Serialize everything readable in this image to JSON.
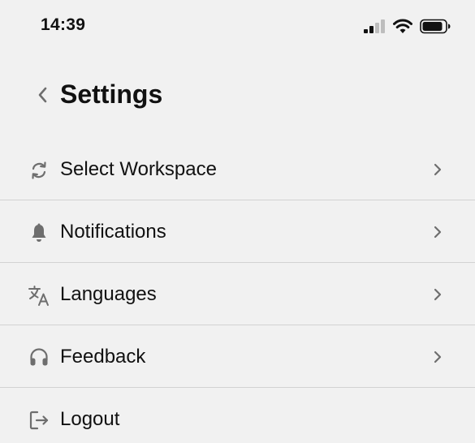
{
  "status_bar": {
    "time": "14:39",
    "icons": [
      "cellular-signal-icon",
      "wifi-icon",
      "battery-icon"
    ]
  },
  "header": {
    "back_icon": "chevron-left-icon",
    "title": "Settings"
  },
  "menu": {
    "items": [
      {
        "label": "Select Workspace",
        "icon": "sync-icon",
        "has_chevron": true
      },
      {
        "label": "Notifications",
        "icon": "bell-icon",
        "has_chevron": true
      },
      {
        "label": "Languages",
        "icon": "translate-icon",
        "has_chevron": true
      },
      {
        "label": "Feedback",
        "icon": "headset-icon",
        "has_chevron": true
      },
      {
        "label": "Logout",
        "icon": "logout-icon",
        "has_chevron": false
      }
    ]
  },
  "colors": {
    "background": "#f1f1f1",
    "text": "#111111",
    "icon": "#6e6e6e",
    "divider": "#d2d2d2"
  }
}
